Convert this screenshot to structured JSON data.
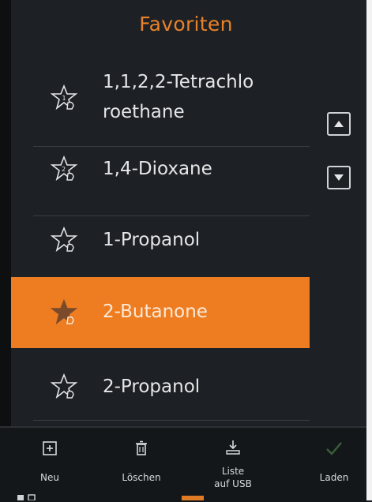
{
  "header": {
    "title": "Favoriten"
  },
  "favorites": [
    {
      "line1": "1,1,2,2-Tetrachlo",
      "line2": "roethane",
      "badge": "1",
      "selected": false
    },
    {
      "line1": "1,4-Dioxane",
      "line2": "",
      "badge": "2",
      "selected": false
    },
    {
      "line1": "1-Propanol",
      "line2": "",
      "badge": "",
      "selected": false
    },
    {
      "line1": "2-Butanone",
      "line2": "",
      "badge": "",
      "selected": true
    },
    {
      "line1": "2-Propanol",
      "line2": "",
      "badge": "",
      "selected": false
    }
  ],
  "toolbar": {
    "new_label": "Neu",
    "delete_label": "Löschen",
    "export_line1": "Liste",
    "export_line2": "auf USB",
    "load_label": "Laden"
  },
  "colors": {
    "accent": "#ee7d22",
    "background": "#1d2024",
    "text": "#e4e6e8",
    "disabled_icon": "#3a5e3a"
  },
  "icons": {
    "favorite": "star-hand-icon",
    "up": "chevron-up-icon",
    "down": "chevron-down-icon",
    "new": "plus-box-icon",
    "delete": "trash-icon",
    "export": "download-usb-icon",
    "load": "checkmark-icon"
  }
}
